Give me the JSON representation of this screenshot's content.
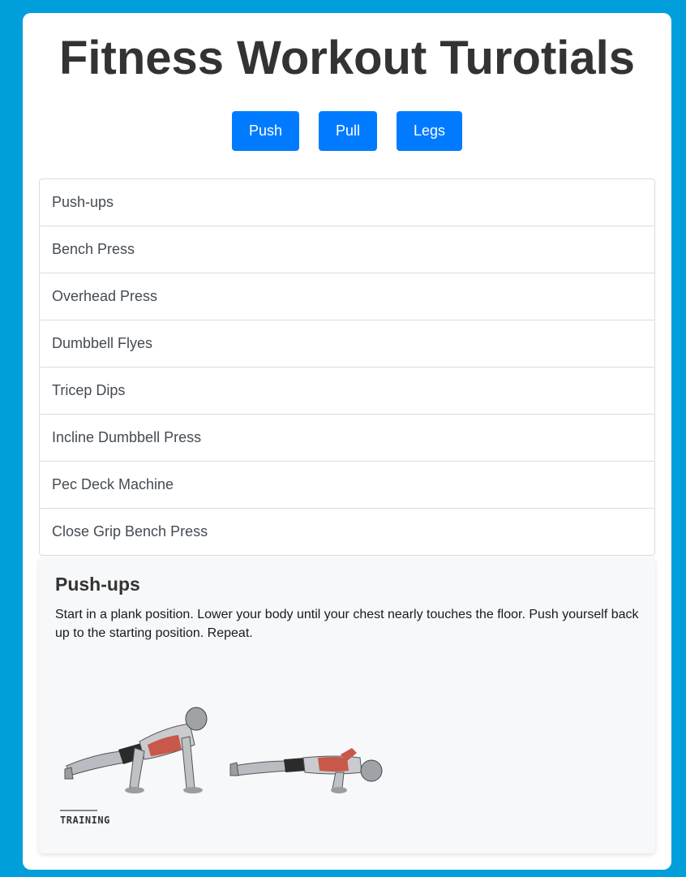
{
  "page": {
    "title": "Fitness Workout Turotials",
    "background_color": "#009fdc",
    "accent_color": "#007bff"
  },
  "categories": [
    {
      "label": "Push"
    },
    {
      "label": "Pull"
    },
    {
      "label": "Legs"
    }
  ],
  "exercises": [
    {
      "name": "Push-ups"
    },
    {
      "name": "Bench Press"
    },
    {
      "name": "Overhead Press"
    },
    {
      "name": "Dumbbell Flyes"
    },
    {
      "name": "Tricep Dips"
    },
    {
      "name": "Incline Dumbbell Press"
    },
    {
      "name": "Pec Deck Machine"
    },
    {
      "name": "Close Grip Bench Press"
    }
  ],
  "detail": {
    "heading": "Push-ups",
    "description": "Start in a plank position. Lower your body until your chest nearly touches the floor. Push yourself back up to the starting position. Repeat.",
    "image_logo_text": "TRAINING",
    "image_icon": "push-up-illustration"
  }
}
